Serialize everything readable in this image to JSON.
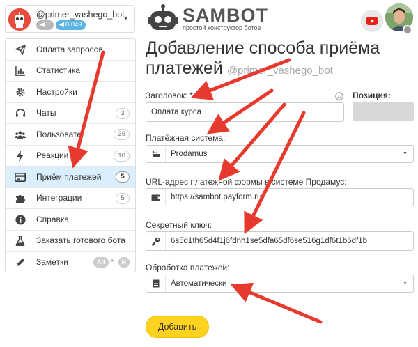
{
  "bot": {
    "name": "@primer_vashego_bot",
    "badge_grey": "0",
    "badge_blue": "8 049"
  },
  "sidebar": {
    "items": [
      {
        "label": "Оплата запросов",
        "icon": "paper-plane-icon",
        "count": ""
      },
      {
        "label": "Статистика",
        "icon": "bar-chart-icon",
        "count": ""
      },
      {
        "label": "Настройки",
        "icon": "gear-icon",
        "count": ""
      },
      {
        "label": "Чаты",
        "icon": "headset-icon",
        "count": "3"
      },
      {
        "label": "Пользовате",
        "icon": "users-icon",
        "count": "39"
      },
      {
        "label": "Реакции",
        "icon": "lightning-icon",
        "count": "10"
      },
      {
        "label": "Приём платежей",
        "icon": "credit-card-icon",
        "count": "5"
      },
      {
        "label": "Интеграции",
        "icon": "puzzle-icon",
        "count": "5"
      },
      {
        "label": "Справка",
        "icon": "info-icon",
        "count": ""
      },
      {
        "label": "Заказать готового бота",
        "icon": "flask-icon",
        "count": ""
      },
      {
        "label": "Заметки",
        "icon": "pencil-icon",
        "count": ""
      }
    ],
    "shortcut": {
      "key1": "Alt",
      "plus": "+",
      "key2": "N"
    }
  },
  "header": {
    "logo": "SAMBOT",
    "tagline": "простой конструктор ботов"
  },
  "main": {
    "title": "Добавление способа приёма платежей",
    "bot_tag": "@primer_vashego_bot",
    "fields": {
      "title_label": "Заголовок: *",
      "title_value": "Оплата курса",
      "position_label": "Позиция:",
      "payment_system_label": "Платёжная система:",
      "payment_system_value": "Prodamus",
      "url_label": "URL-адрес платежной формы в системе Продамус:",
      "url_value": "https://sambot.payform.ru",
      "secret_label": "Секретный ключ:",
      "secret_value": "6s5d1th65d4f1j6fdnh1se5dfa65df6se516g1df6t1b6df1b",
      "processing_label": "Обработка платежей:",
      "processing_value": "Автоматически"
    },
    "add_button": "Добавить"
  },
  "colors": {
    "accent_yellow": "#ffd21f",
    "active_bg": "#dbeefb",
    "arrow_red": "#e8392e",
    "badge_blue": "#5bb5e0"
  }
}
